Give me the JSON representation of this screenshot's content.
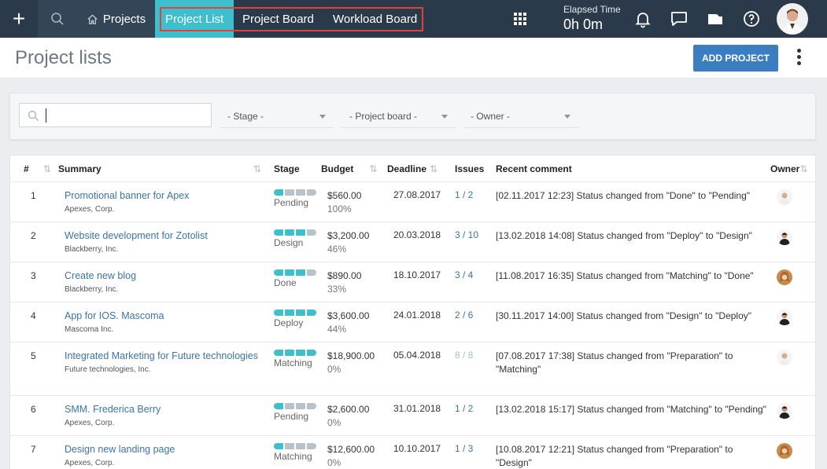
{
  "topbar": {
    "projects_label": "Projects",
    "tabs": [
      "Project List",
      "Project Board",
      "Workload Board"
    ],
    "elapsed_label": "Elapsed Time",
    "elapsed_value": "0h 0m"
  },
  "header": {
    "title": "Project lists",
    "add_button": "ADD PROJECT"
  },
  "filters": {
    "search_value": "",
    "stage": "- Stage -",
    "project_board": "- Project board -",
    "owner": "- Owner -"
  },
  "table": {
    "columns": [
      "#",
      "Summary",
      "Stage",
      "Budget",
      "Deadline",
      "Issues",
      "Recent comment",
      "Owner"
    ],
    "rows": [
      {
        "num": "1",
        "title": "Promotional banner for Apex",
        "client": "Apexes, Corp.",
        "stage": "Pending",
        "stage_level": 1,
        "budget": "$560.00",
        "pct": "100%",
        "deadline": "27.08.2017",
        "issues": "1 / 2",
        "comment": "[02.11.2017 12:23] Status changed from \"Done\" to \"Pending\""
      },
      {
        "num": "2",
        "title": "Website development for Zotolist",
        "client": "Blackberry, Inc.",
        "stage": "Design",
        "stage_level": 3,
        "budget": "$3,200.00",
        "pct": "46%",
        "deadline": "20.03.2018",
        "issues": "3 / 10",
        "comment": "[13.02.2018 14:08] Status changed from \"Deploy\" to \"Design\""
      },
      {
        "num": "3",
        "title": "Create new blog",
        "client": "Blackberry, Inc.",
        "stage": "Done",
        "stage_level": 3,
        "budget": "$890.00",
        "pct": "33%",
        "deadline": "18.10.2017",
        "issues": "3 / 4",
        "comment": "[11.08.2017 16:35] Status changed from \"Matching\" to \"Done\""
      },
      {
        "num": "4",
        "title": "App for IOS. Mascoma",
        "client": "Mascoma Inc.",
        "stage": "Deploy",
        "stage_level": 4,
        "budget": "$3,600.00",
        "pct": "44%",
        "deadline": "24.01.2018",
        "issues": "2 / 6",
        "comment": "[30.11.2017 14:00] Status changed from \"Design\" to \"Deploy\""
      },
      {
        "num": "5",
        "title": "Integrated Marketing for Future technologies",
        "client": "Future technologies, Inc.",
        "stage": "Matching",
        "stage_level": 4,
        "budget": "$18,900.00",
        "pct": "0%",
        "deadline": "05.04.2018",
        "issues": "8 / 8",
        "comment": "[07.08.2017 17:38] Status changed from \"Preparation\" to \"Matching\""
      },
      {
        "num": "6",
        "title": "SMM. Frederica Berry",
        "client": "Apexes, Corp.",
        "stage": "Pending",
        "stage_level": 1,
        "budget": "$2,600.00",
        "pct": "0%",
        "deadline": "31.01.2018",
        "issues": "1 / 2",
        "comment": "[13.02.2018 15:17] Status changed from \"Matching\" to \"Pending\""
      },
      {
        "num": "7",
        "title": "Design new landing page",
        "client": "Apexes, Corp.",
        "stage": "Matching",
        "stage_level": 1,
        "budget": "$12,600.00",
        "pct": "0%",
        "deadline": "10.10.2017",
        "issues": "1 / 3",
        "comment": "[10.08.2017 12:21] Status changed from \"Preparation\" to \"Design\""
      }
    ]
  },
  "colors": {
    "accent": "#3dbfce",
    "topbar": "#2b3a4a",
    "button": "#3a7ec1",
    "link": "#3a74a8",
    "highlight": "#d9453a"
  }
}
